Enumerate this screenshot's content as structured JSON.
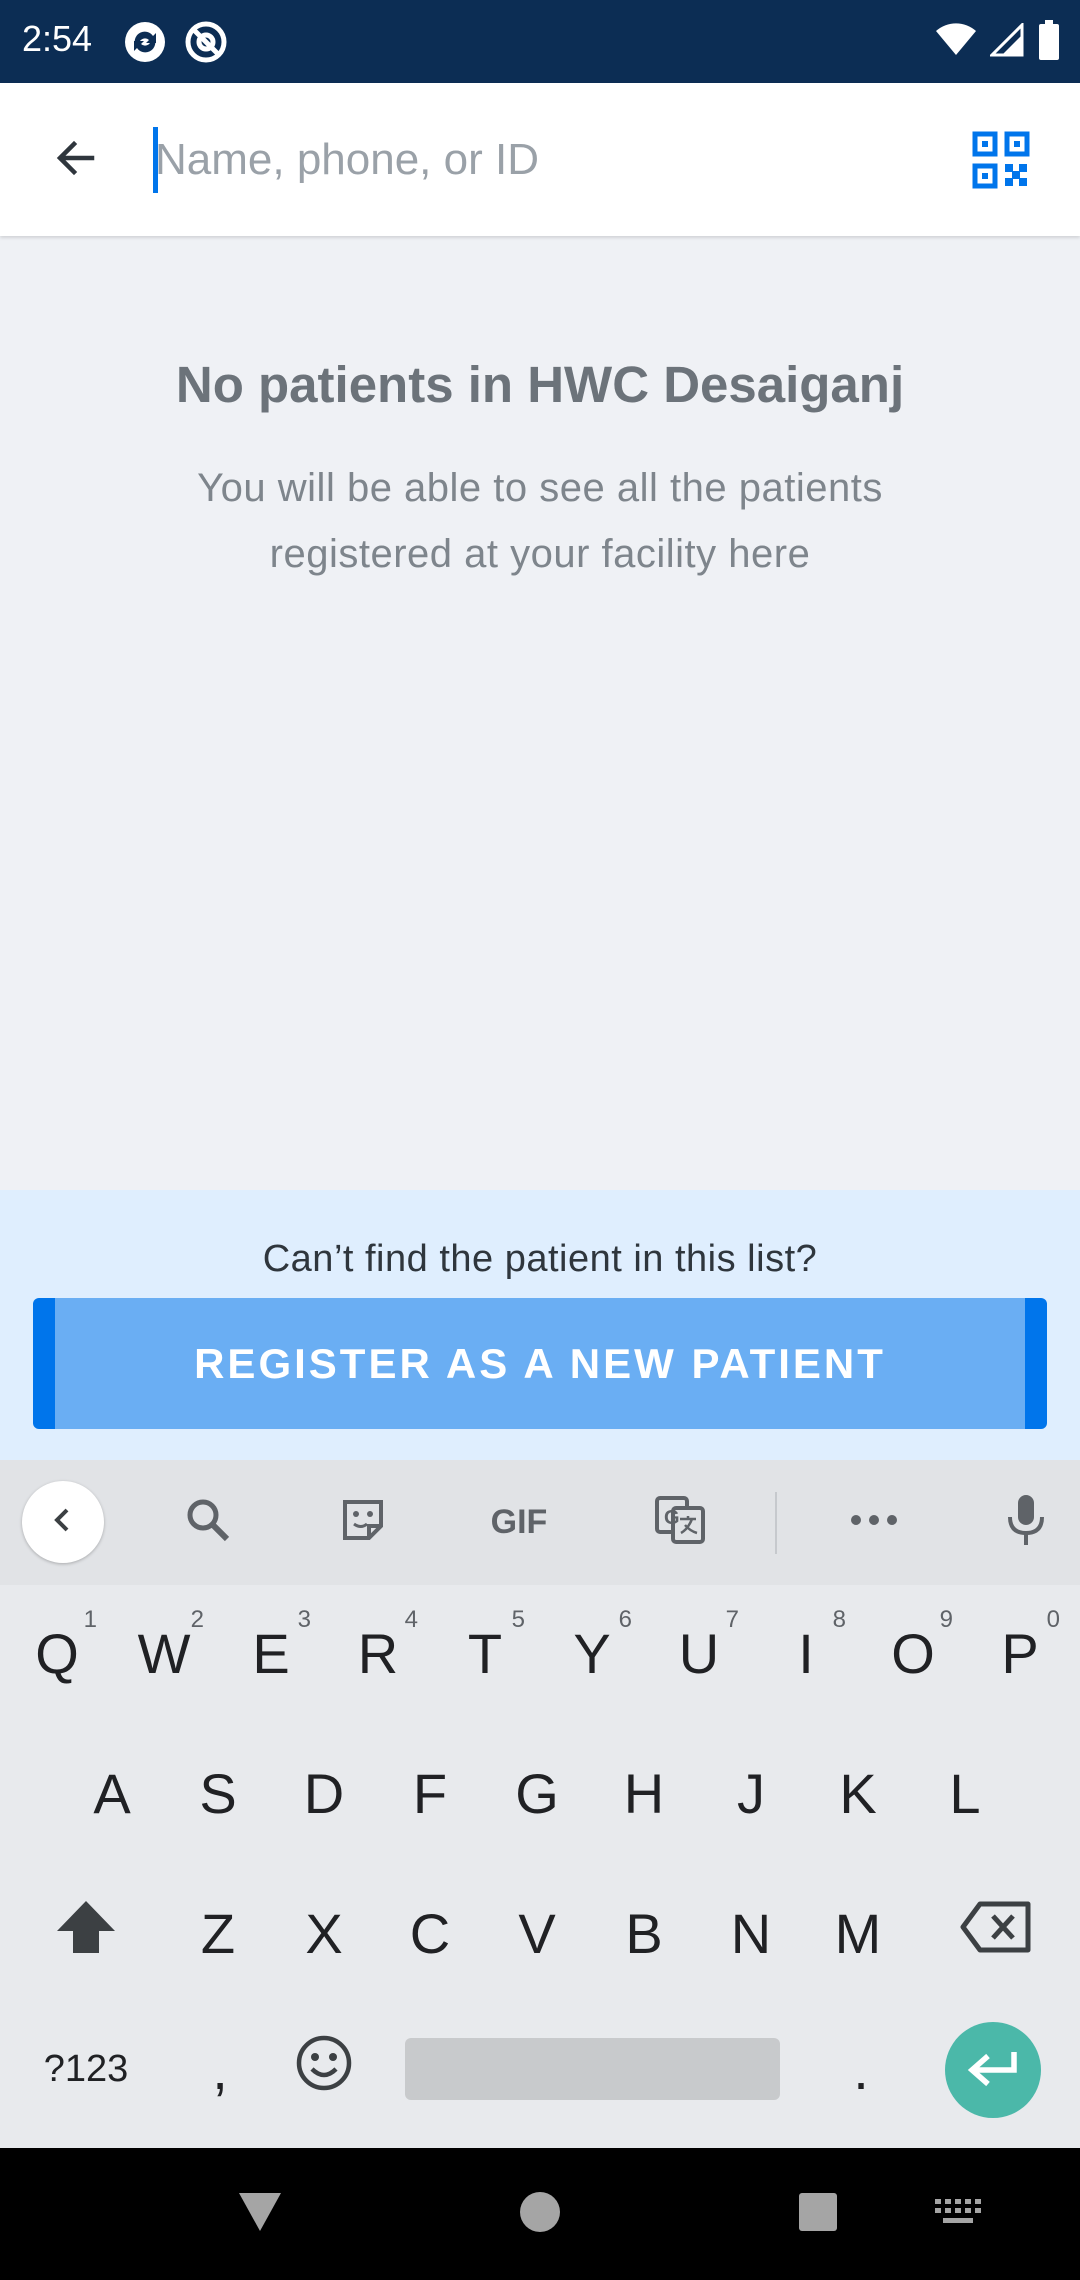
{
  "status_bar": {
    "time": "2:54",
    "icons": [
      "sync-app-icon",
      "at-sign-app-icon",
      "wifi-icon",
      "signal-icon",
      "battery-icon"
    ]
  },
  "search": {
    "placeholder": "Name, phone, or ID",
    "value": "",
    "back_icon": "arrow-back-icon",
    "qr_icon": "qr-code-icon",
    "accent_color": "#0075eb"
  },
  "empty_state": {
    "title": "No patients in HWC Desaiganj",
    "description": "You will be able to see all the patients registered at your facility here"
  },
  "register": {
    "prompt": "Can’t find the patient in this list?",
    "button_label": "REGISTER AS A NEW PATIENT",
    "button_color": "#6aaef3"
  },
  "keyboard": {
    "toolbar": {
      "gif_label": "GIF",
      "icons": [
        "chevron-left-icon",
        "search-icon",
        "sticker-icon",
        "gif-icon",
        "translate-icon",
        "more-horiz-icon",
        "mic-icon"
      ]
    },
    "row1": [
      {
        "k": "Q",
        "h": "1"
      },
      {
        "k": "W",
        "h": "2"
      },
      {
        "k": "E",
        "h": "3"
      },
      {
        "k": "R",
        "h": "4"
      },
      {
        "k": "T",
        "h": "5"
      },
      {
        "k": "Y",
        "h": "6"
      },
      {
        "k": "U",
        "h": "7"
      },
      {
        "k": "I",
        "h": "8"
      },
      {
        "k": "O",
        "h": "9"
      },
      {
        "k": "P",
        "h": "0"
      }
    ],
    "row2": [
      "A",
      "S",
      "D",
      "F",
      "G",
      "H",
      "J",
      "K",
      "L"
    ],
    "row3": [
      "Z",
      "X",
      "C",
      "V",
      "B",
      "N",
      "M"
    ],
    "symbols_label": "?123",
    "comma": ",",
    "period": ".",
    "enter_color": "#4bb8a9"
  },
  "nav_bar": {
    "icons": [
      "back-triangle-icon",
      "home-circle-icon",
      "recents-square-icon",
      "keyboard-switch-icon"
    ]
  }
}
